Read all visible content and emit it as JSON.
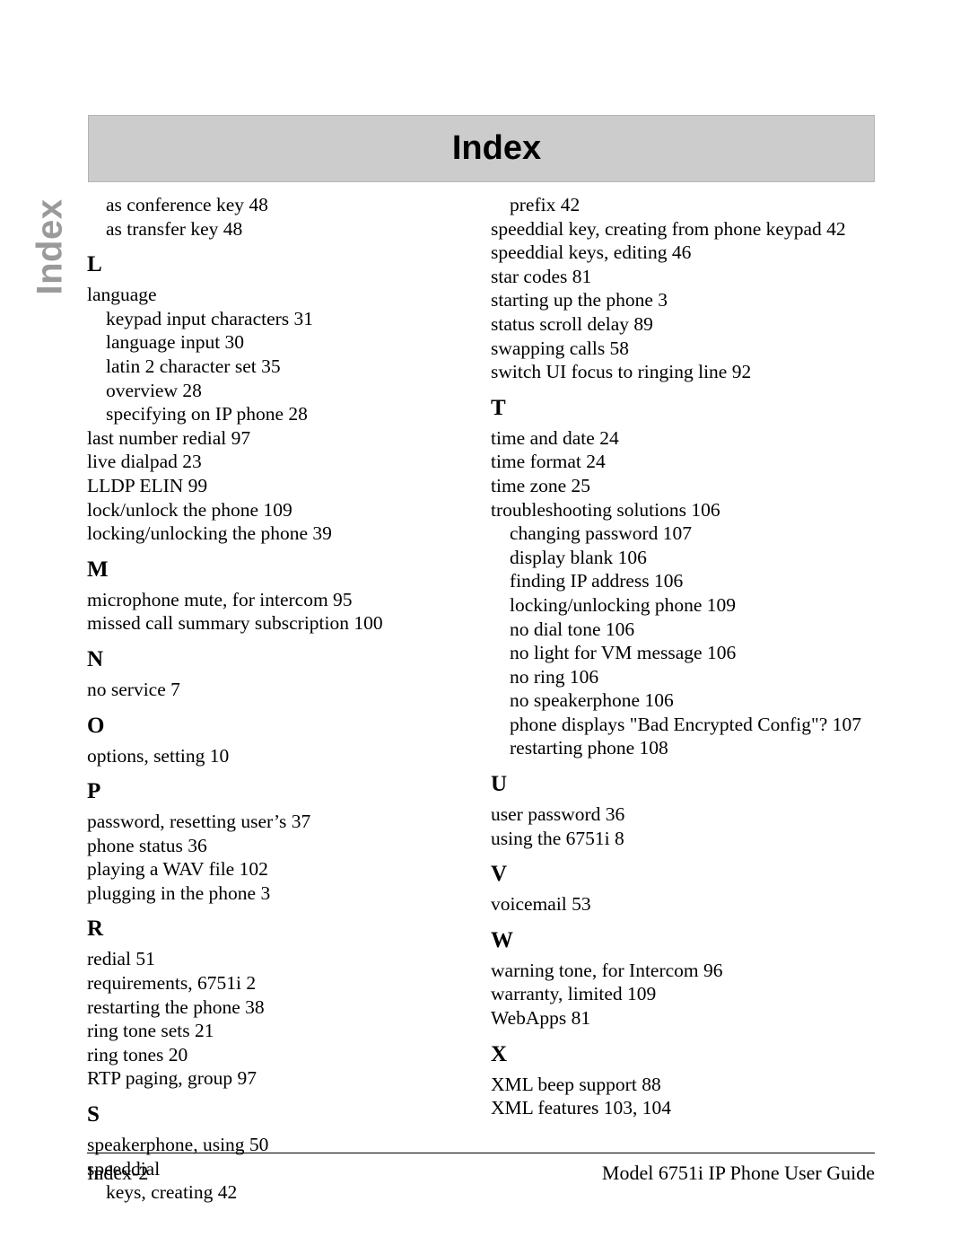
{
  "page": {
    "banner_title": "Index",
    "side_tab_label": "Index",
    "banner_color": "#cccccc",
    "side_tab_color": "#9a9a9a"
  },
  "footer": {
    "left": "Index-2",
    "right": "Model 6751i IP Phone User Guide"
  },
  "index": {
    "left_column": [
      {
        "type": "entry",
        "level": 2,
        "text": "as conference key 48"
      },
      {
        "type": "entry",
        "level": 2,
        "text": "as transfer key 48"
      },
      {
        "type": "letter",
        "text": "L"
      },
      {
        "type": "entry",
        "level": 1,
        "text": "language"
      },
      {
        "type": "entry",
        "level": 2,
        "text": "keypad input characters 31"
      },
      {
        "type": "entry",
        "level": 2,
        "text": "language input 30"
      },
      {
        "type": "entry",
        "level": 2,
        "text": "latin 2 character set 35"
      },
      {
        "type": "entry",
        "level": 2,
        "text": "overview 28"
      },
      {
        "type": "entry",
        "level": 2,
        "text": "specifying on IP phone 28"
      },
      {
        "type": "entry",
        "level": 1,
        "text": "last number redial 97"
      },
      {
        "type": "entry",
        "level": 1,
        "text": "live dialpad 23"
      },
      {
        "type": "entry",
        "level": 1,
        "text": "LLDP ELIN 99"
      },
      {
        "type": "entry",
        "level": 1,
        "text": "lock/unlock the phone 109"
      },
      {
        "type": "entry",
        "level": 1,
        "text": "locking/unlocking the phone 39"
      },
      {
        "type": "letter",
        "text": "M"
      },
      {
        "type": "entry",
        "level": 1,
        "text": "microphone mute, for intercom 95"
      },
      {
        "type": "entry",
        "level": 1,
        "text": "missed call summary subscription 100"
      },
      {
        "type": "letter",
        "text": "N"
      },
      {
        "type": "entry",
        "level": 1,
        "text": "no service 7"
      },
      {
        "type": "letter",
        "text": "O"
      },
      {
        "type": "entry",
        "level": 1,
        "text": "options, setting 10"
      },
      {
        "type": "letter",
        "text": "P"
      },
      {
        "type": "entry",
        "level": 1,
        "text": "password, resetting user’s 37"
      },
      {
        "type": "entry",
        "level": 1,
        "text": "phone status 36"
      },
      {
        "type": "entry",
        "level": 1,
        "text": "playing a WAV file 102"
      },
      {
        "type": "entry",
        "level": 1,
        "text": "plugging in the phone 3"
      },
      {
        "type": "letter",
        "text": "R"
      },
      {
        "type": "entry",
        "level": 1,
        "text": "redial 51"
      },
      {
        "type": "entry",
        "level": 1,
        "text": "requirements, 6751i 2"
      },
      {
        "type": "entry",
        "level": 1,
        "text": "restarting the phone 38"
      },
      {
        "type": "entry",
        "level": 1,
        "text": "ring tone sets 21"
      },
      {
        "type": "entry",
        "level": 1,
        "text": "ring tones 20"
      },
      {
        "type": "entry",
        "level": 1,
        "text": "RTP paging, group 97"
      },
      {
        "type": "letter",
        "text": "S"
      },
      {
        "type": "entry",
        "level": 1,
        "text": "speakerphone, using 50"
      },
      {
        "type": "entry",
        "level": 1,
        "text": "speeddial"
      },
      {
        "type": "entry",
        "level": 2,
        "text": "keys, creating 42"
      }
    ],
    "right_column": [
      {
        "type": "entry",
        "level": 2,
        "text": "prefix 42"
      },
      {
        "type": "entry",
        "level": 1,
        "text": "speeddial key, creating from phone keypad 42"
      },
      {
        "type": "entry",
        "level": 1,
        "text": "speeddial keys, editing 46"
      },
      {
        "type": "entry",
        "level": 1,
        "text": "star codes 81"
      },
      {
        "type": "entry",
        "level": 1,
        "text": "starting up the phone 3"
      },
      {
        "type": "entry",
        "level": 1,
        "text": "status scroll delay 89"
      },
      {
        "type": "entry",
        "level": 1,
        "text": "swapping calls 58"
      },
      {
        "type": "entry",
        "level": 1,
        "text": "switch UI focus to ringing line 92"
      },
      {
        "type": "letter",
        "text": "T"
      },
      {
        "type": "entry",
        "level": 1,
        "text": "time and date 24"
      },
      {
        "type": "entry",
        "level": 1,
        "text": "time format 24"
      },
      {
        "type": "entry",
        "level": 1,
        "text": "time zone 25"
      },
      {
        "type": "entry",
        "level": 1,
        "text": "troubleshooting solutions 106"
      },
      {
        "type": "entry",
        "level": 2,
        "text": "changing password 107"
      },
      {
        "type": "entry",
        "level": 2,
        "text": "display blank 106"
      },
      {
        "type": "entry",
        "level": 2,
        "text": "finding IP address 106"
      },
      {
        "type": "entry",
        "level": 2,
        "text": "locking/unlocking phone 109"
      },
      {
        "type": "entry",
        "level": 2,
        "text": "no dial tone 106"
      },
      {
        "type": "entry",
        "level": 2,
        "text": "no light for VM message 106"
      },
      {
        "type": "entry",
        "level": 2,
        "text": "no ring 106"
      },
      {
        "type": "entry",
        "level": 2,
        "text": "no speakerphone 106"
      },
      {
        "type": "entry",
        "level": 2,
        "text": "phone displays \"Bad Encrypted Config\"? 107"
      },
      {
        "type": "entry",
        "level": 2,
        "text": "restarting phone 108"
      },
      {
        "type": "letter",
        "text": "U"
      },
      {
        "type": "entry",
        "level": 1,
        "text": "user password 36"
      },
      {
        "type": "entry",
        "level": 1,
        "text": "using the 6751i 8"
      },
      {
        "type": "letter",
        "text": "V"
      },
      {
        "type": "entry",
        "level": 1,
        "text": "voicemail 53"
      },
      {
        "type": "letter",
        "text": "W"
      },
      {
        "type": "entry",
        "level": 1,
        "text": "warning tone, for Intercom 96"
      },
      {
        "type": "entry",
        "level": 1,
        "text": "warranty, limited 109"
      },
      {
        "type": "entry",
        "level": 1,
        "text": "WebApps 81"
      },
      {
        "type": "letter",
        "text": "X"
      },
      {
        "type": "entry",
        "level": 1,
        "text": "XML beep support 88"
      },
      {
        "type": "entry",
        "level": 1,
        "text": "XML features 103, 104"
      }
    ]
  }
}
